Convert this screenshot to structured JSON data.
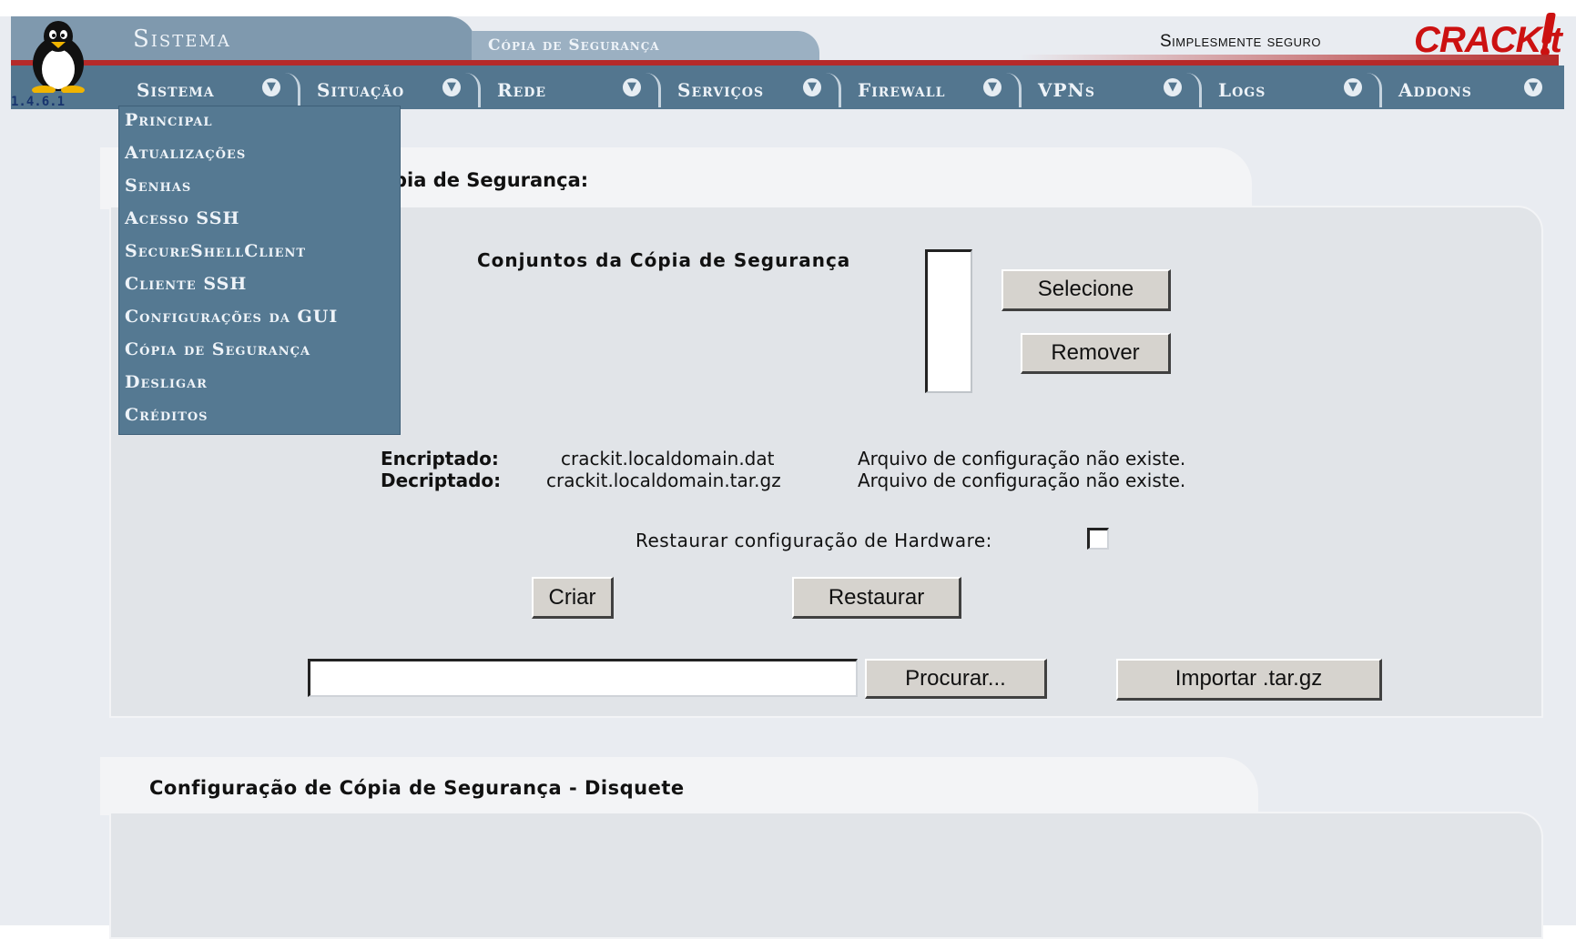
{
  "header": {
    "section_title": "Sistema",
    "page_tab": "Cópia de Segurança",
    "slogan": "Simplesmente seguro",
    "brand": "CRACKit",
    "version": "1.4.6.1"
  },
  "menu": {
    "tabs": [
      {
        "label": "Sistema"
      },
      {
        "label": "Situação"
      },
      {
        "label": "Rede"
      },
      {
        "label": "Serviços"
      },
      {
        "label": "Firewall"
      },
      {
        "label": "VPNs"
      },
      {
        "label": "Logs"
      },
      {
        "label": "Addons"
      }
    ],
    "dropdown": [
      "Principal",
      "Atualizações",
      "Senhas",
      "Acesso SSH",
      "SecureShellClient",
      "Cliente SSH",
      "Configurações da GUI",
      "Cópia de Segurança",
      "Desligar",
      "Créditos"
    ]
  },
  "backup_panel": {
    "title_visible": "pia de Segurança:",
    "sets_label": "Conjuntos da Cópia de Segurança",
    "select_button": "Selecione",
    "remove_button": "Remover",
    "encrypted_label": "Encriptado:",
    "encrypted_file": "crackit.localdomain.dat",
    "encrypted_status": "Arquivo de configuração não existe.",
    "decrypted_label": "Decriptado:",
    "decrypted_file": "crackit.localdomain.tar.gz",
    "decrypted_status": "Arquivo de configuração não existe.",
    "restore_hw_label": "Restaurar configuração de Hardware:",
    "create_button": "Criar",
    "restore_button": "Restaurar",
    "file_input_value": "",
    "browse_button": "Procurar...",
    "import_button": "Importar .tar.gz"
  },
  "floppy_panel": {
    "title": "Configuração de Cópia de Segurança - Disquete"
  },
  "colors": {
    "menubar": "#53768f",
    "dropdown": "#557992",
    "accent_red": "#b52a2a",
    "brand_red": "#cc1111",
    "panel": "#e1e4e8"
  }
}
